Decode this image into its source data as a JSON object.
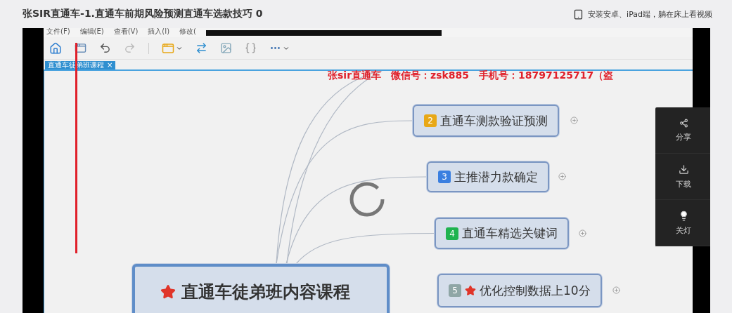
{
  "page_title": "张SIR直通车-1.直通车前期风险预测直通车选款技巧 0",
  "app_promo": "安装安卓、iPad端，躺在床上看视频",
  "video": {
    "menu": [
      "文件(F)",
      "编辑(E)",
      "查看(V)",
      "插入(I)",
      "修改("
    ],
    "tab": {
      "label": "直通车徒弟班课程",
      "close": "×"
    },
    "banner": {
      "name": "张sir直通车",
      "wechat": "微信号：zsk885",
      "phone": "手机号：18797125717（盗"
    },
    "root": {
      "label": "直通车徒弟班内容课程",
      "starred": true
    },
    "branches": [
      {
        "number": "2",
        "color": "#e8a817",
        "starred": false,
        "label": "直通车测款验证预测"
      },
      {
        "number": "3",
        "color": "#3a7fe0",
        "starred": false,
        "label": "主推潜力款确定"
      },
      {
        "number": "4",
        "color": "#1fb34f",
        "starred": false,
        "label": "直通车精选关键词"
      },
      {
        "number": "5",
        "color": "#8fa6a6",
        "starred": true,
        "label": "优化控制数据上10分"
      }
    ],
    "loading": true
  },
  "side_actions": [
    {
      "kind": "share",
      "label": "分享"
    },
    {
      "kind": "download",
      "label": "下载"
    },
    {
      "kind": "light",
      "label": "关灯"
    }
  ]
}
